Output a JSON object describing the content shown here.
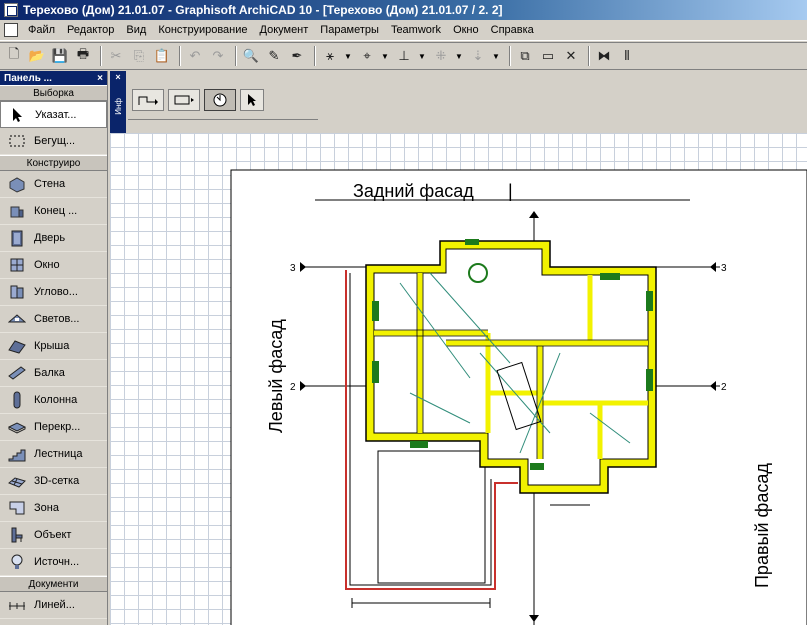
{
  "window": {
    "title": "Терехово (Дом) 21.01.07 - Graphisoft ArchiCAD 10 - [Терехово (Дом) 21.01.07 / 2. 2]"
  },
  "menu": [
    "Файл",
    "Редактор",
    "Вид",
    "Конструирование",
    "Документ",
    "Параметры",
    "Teamwork",
    "Окно",
    "Справка"
  ],
  "toolbar": {
    "icons": [
      "new-icon",
      "open-icon",
      "save-icon",
      "print-icon",
      "cut-icon",
      "copy-icon",
      "paste-icon",
      "undo-icon",
      "redo-icon",
      "find-select-icon",
      "eyedropper-icon",
      "syringe-icon",
      "magic-wand-icon",
      "snap-icon",
      "guide-line-icon",
      "gravity-icon",
      "grid-snap-icon",
      "suspend-groups-icon",
      "layer-icon",
      "window-icon",
      "close-x-icon",
      "trace-icon",
      "section-icon"
    ]
  },
  "panel": {
    "title": "Панель ...",
    "close": "×",
    "sections": {
      "selection": "Выборка",
      "design": "Конструиро",
      "document": "Документи"
    },
    "selection_tools": [
      {
        "label": "Указат...",
        "icon": "arrow-pointer-icon"
      },
      {
        "label": "Бегущ...",
        "icon": "marquee-icon"
      }
    ],
    "design_tools": [
      {
        "label": "Стена",
        "icon": "wall-icon"
      },
      {
        "label": "Конец ...",
        "icon": "wall-end-icon"
      },
      {
        "label": "Дверь",
        "icon": "door-icon"
      },
      {
        "label": "Окно",
        "icon": "window-tool-icon"
      },
      {
        "label": "Углово...",
        "icon": "corner-window-icon"
      },
      {
        "label": "Светов...",
        "icon": "skylight-icon"
      },
      {
        "label": "Крыша",
        "icon": "roof-icon"
      },
      {
        "label": "Балка",
        "icon": "beam-icon"
      },
      {
        "label": "Колонна",
        "icon": "column-icon"
      },
      {
        "label": "Перекр...",
        "icon": "slab-icon"
      },
      {
        "label": "Лестница",
        "icon": "stair-icon"
      },
      {
        "label": "3D-сетка",
        "icon": "mesh-icon"
      },
      {
        "label": "Зона",
        "icon": "zone-icon"
      },
      {
        "label": "Объект",
        "icon": "object-icon"
      },
      {
        "label": "Источн...",
        "icon": "lamp-icon"
      }
    ],
    "document_tools": [
      {
        "label": "Линей...",
        "icon": "dimension-icon"
      }
    ]
  },
  "info_strip": {
    "close": "×",
    "label": "Инф"
  },
  "drawing": {
    "labels": {
      "back": "Задний фасад",
      "left": "Левый фасад",
      "right": "Правый фасад"
    },
    "axis_markers": [
      "3",
      "2",
      "3",
      "2"
    ],
    "colors": {
      "wall_fill": "#f2f200",
      "furniture": "#1c7a1c",
      "outline": "#000000",
      "accent_red": "#c8302c",
      "dimension_teal": "#2f8c7a"
    }
  }
}
